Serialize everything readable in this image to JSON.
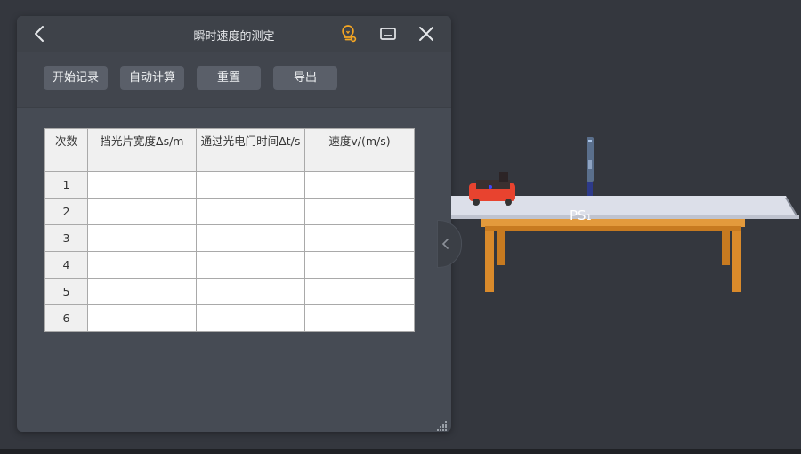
{
  "window": {
    "title": "瞬时速度的测定",
    "icons": {
      "back": "chevron-left-icon",
      "tip": "lightbulb-icon",
      "minimize": "minimize-icon",
      "close": "close-icon"
    },
    "accent_color": "#f5a623"
  },
  "toolbar": {
    "start_record_label": "开始记录",
    "auto_calc_label": "自动计算",
    "reset_label": "重置",
    "export_label": "导出"
  },
  "table": {
    "headers": [
      "次数",
      "挡光片宽度Δs/m",
      "通过光电门时间Δt/s",
      "速度v/(m/s)"
    ],
    "rows": [
      [
        "1",
        "",
        "",
        ""
      ],
      [
        "2",
        "",
        "",
        ""
      ],
      [
        "3",
        "",
        "",
        ""
      ],
      [
        "4",
        "",
        "",
        ""
      ],
      [
        "5",
        "",
        "",
        ""
      ],
      [
        "6",
        "",
        "",
        ""
      ]
    ]
  },
  "scene": {
    "track_label": "PS₁",
    "colors": {
      "cart": "#e8432f",
      "track": "#dcdfe9",
      "table_wood": "#d98a2b"
    }
  }
}
